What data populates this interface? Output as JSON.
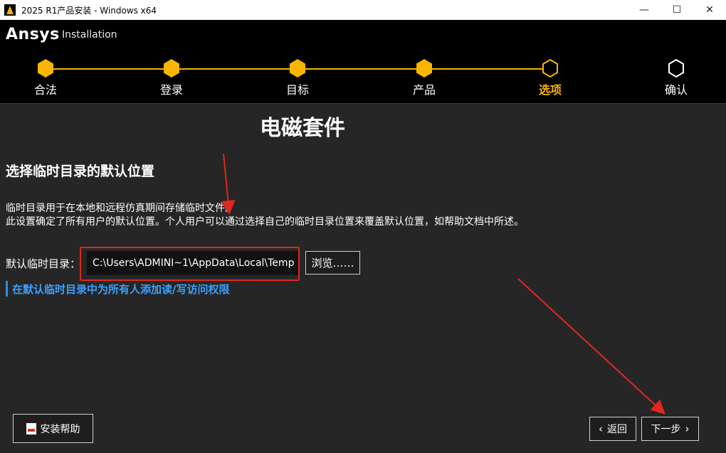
{
  "window": {
    "title": "2025 R1产品安装 - Windows x64",
    "minimize": "—",
    "maximize": "☐",
    "close": "✕"
  },
  "header": {
    "logo": "Ansys",
    "subtitle": "Installation",
    "steps": [
      {
        "label": "合法",
        "state": "done"
      },
      {
        "label": "登录",
        "state": "done"
      },
      {
        "label": "目标",
        "state": "done"
      },
      {
        "label": "产品",
        "state": "done"
      },
      {
        "label": "选项",
        "state": "active"
      },
      {
        "label": "确认",
        "state": "pending"
      }
    ]
  },
  "main": {
    "product_title": "电磁套件",
    "section_title": "选择临时目录的默认位置",
    "desc_line1": "临时目录用于在本地和远程仿真期间存储临时文件。",
    "desc_line2": "此设置确定了所有用户的默认位置。个人用户可以通过选择自己的临时目录位置来覆盖默认位置，如帮助文档中所述。",
    "field_label": "默认临时目录：",
    "temp_dir_value": "C:\\Users\\ADMINI~1\\AppData\\Local\\Temp",
    "browse_label": "浏览……",
    "permission_link": "在默认临时目录中为所有人添加读/写访问权限"
  },
  "footer": {
    "help_label": "安装帮助",
    "back_label": "返回",
    "next_label": "下一步"
  },
  "colors": {
    "accent": "#f7b500",
    "link": "#3aa0ff",
    "annotation": "#e0281e"
  },
  "icons": {
    "back": "chevron-left-icon",
    "next": "chevron-right-icon",
    "help": "pdf-icon"
  }
}
